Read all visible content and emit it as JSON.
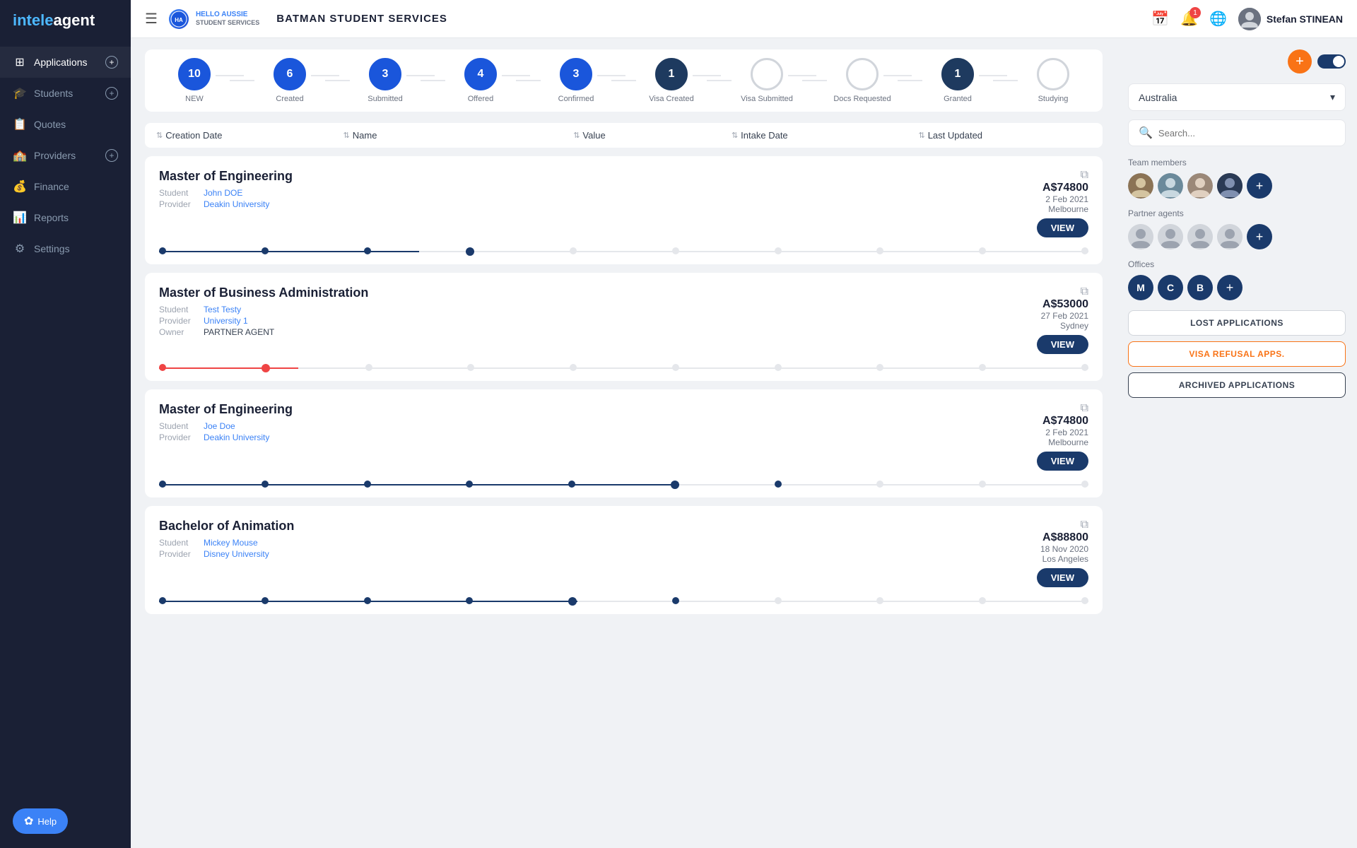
{
  "sidebar": {
    "logo": "intele",
    "logo_accent": "agent",
    "nav_items": [
      {
        "id": "applications",
        "label": "Applications",
        "icon": "⊞",
        "has_plus": true,
        "active": true
      },
      {
        "id": "students",
        "label": "Students",
        "icon": "🎓",
        "has_plus": true
      },
      {
        "id": "quotes",
        "label": "Quotes",
        "icon": "📋",
        "has_plus": false
      },
      {
        "id": "providers",
        "label": "Providers",
        "icon": "🏫",
        "has_plus": true
      },
      {
        "id": "finance",
        "label": "Finance",
        "icon": "💰",
        "has_plus": false
      },
      {
        "id": "reports",
        "label": "Reports",
        "icon": "📊",
        "has_plus": false
      },
      {
        "id": "settings",
        "label": "Settings",
        "icon": "⚙",
        "has_plus": false
      }
    ],
    "help_label": "Help"
  },
  "topbar": {
    "brand_name_line1": "HELLO AUSSIE",
    "brand_name_line2": "STUDENT SERVICES",
    "title": "BATMAN STUDENT SERVICES",
    "user_name": "Stefan STINEAN",
    "notification_count": "1"
  },
  "status_items": [
    {
      "label": "NEW",
      "value": "10",
      "style": "filled-blue"
    },
    {
      "label": "Created",
      "value": "6",
      "style": "filled-blue"
    },
    {
      "label": "Submitted",
      "value": "3",
      "style": "filled-blue"
    },
    {
      "label": "Offered",
      "value": "4",
      "style": "filled-blue"
    },
    {
      "label": "Confirmed",
      "value": "3",
      "style": "filled-blue"
    },
    {
      "label": "Visa Created",
      "value": "1",
      "style": "filled-dark"
    },
    {
      "label": "Visa Submitted",
      "value": "",
      "style": "empty"
    },
    {
      "label": "Docs Requested",
      "value": "",
      "style": "empty"
    },
    {
      "label": "Granted",
      "value": "1",
      "style": "filled-dark"
    },
    {
      "label": "Studying",
      "value": "",
      "style": "empty"
    }
  ],
  "table_columns": [
    {
      "label": "Creation Date"
    },
    {
      "label": "Name"
    },
    {
      "label": "Value"
    },
    {
      "label": "Intake Date"
    },
    {
      "label": "Last Updated"
    }
  ],
  "applications": [
    {
      "id": "app1",
      "title": "Master of Engineering",
      "student": "John DOE",
      "provider": "Deakin University",
      "owner": null,
      "value": "A$74800",
      "date": "2 Feb 2021",
      "location": "Melbourne",
      "progress": 3,
      "total_steps": 10,
      "bar_color": "#1a3a6b"
    },
    {
      "id": "app2",
      "title": "Master of Business Administration",
      "student": "Test Testy",
      "provider": "University 1",
      "owner": "PARTNER AGENT",
      "value": "A$53000",
      "date": "27 Feb 2021",
      "location": "Sydney",
      "progress": 2,
      "total_steps": 10,
      "bar_color": "#ef4444"
    },
    {
      "id": "app3",
      "title": "Master of Engineering",
      "student": "Joe Doe",
      "provider": "Deakin University",
      "owner": null,
      "value": "A$74800",
      "date": "2 Feb 2021",
      "location": "Melbourne",
      "progress": 6,
      "total_steps": 10,
      "bar_color": "#1a3a6b"
    },
    {
      "id": "app4",
      "title": "Bachelor of Animation",
      "student": "Mickey Mouse",
      "provider": "Disney University",
      "owner": null,
      "value": "A$88800",
      "date": "18 Nov 2020",
      "location": "Los Angeles",
      "progress": 5,
      "total_steps": 10,
      "bar_color": "#1a3a6b"
    }
  ],
  "right_panel": {
    "country": "Australia",
    "search_placeholder": "Search...",
    "team_members_label": "Team members",
    "partner_agents_label": "Partner agents",
    "offices_label": "Offices",
    "office_letters": [
      "M",
      "C",
      "B"
    ],
    "action_buttons": [
      {
        "label": "LOST APPLICATIONS",
        "style": "default"
      },
      {
        "label": "VISA REFUSAL APPS.",
        "style": "orange"
      },
      {
        "label": "ARCHIVED APPLICATIONS",
        "style": "dark"
      }
    ]
  }
}
